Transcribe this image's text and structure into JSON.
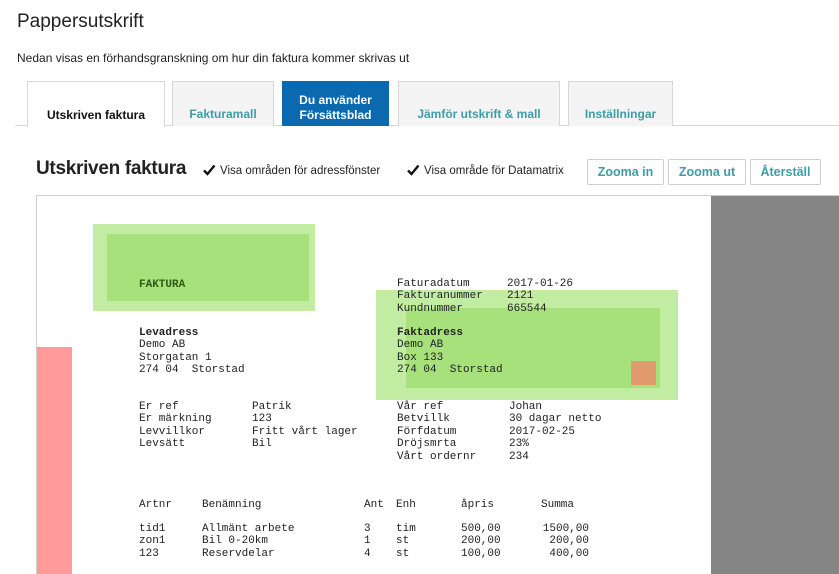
{
  "page": {
    "title": "Pappersutskrift",
    "subtitle": "Nedan visas en förhandsgranskning om hur din faktura kommer skrivas ut"
  },
  "tabs": [
    {
      "label": "Utskriven faktura",
      "state": "active"
    },
    {
      "label": "Fakturamall",
      "state": "normal"
    },
    {
      "label_line1": "Du använder",
      "label_line2": "Försättsblad",
      "state": "primary"
    },
    {
      "label": "Jämför utskrift & mall",
      "state": "normal"
    },
    {
      "label": "Inställningar",
      "state": "normal"
    }
  ],
  "toolbar": {
    "title": "Utskriven faktura",
    "checkbox_address": {
      "label": "Visa områden för adressfönster",
      "checked": true
    },
    "checkbox_datamatrix": {
      "label": "Visa område för Datamatrix",
      "checked": true
    },
    "zoom_in": "Zooma in",
    "zoom_out": "Zooma ut",
    "reset": "Återställ"
  },
  "colors": {
    "accent": "#3f9ca6",
    "primary_tab": "#0b69b0",
    "address_window": "#a7e17c",
    "address_window_margin": "#c3eca3",
    "datamatrix": "#e39a6e",
    "red_margin": "#ff9b9b",
    "gray_margin": "#858585"
  },
  "invoice": {
    "heading": "FAKTURA",
    "meta_labels": [
      "Faturadatum",
      "Fakturanummer",
      "Kundnummer"
    ],
    "meta_values": [
      "2017-01-26",
      "2121",
      "665544"
    ],
    "delivery": {
      "title": "Levadress",
      "lines": [
        "Demo AB",
        "Storgatan 1",
        "274 04  Storstad"
      ]
    },
    "billing": {
      "title": "Faktadress",
      "lines": [
        "Demo AB",
        "Box 133",
        "274 04  Storstad"
      ]
    },
    "ref_left_labels": [
      "Er ref",
      "Er märkning",
      "Levvillkor",
      "Levsätt"
    ],
    "ref_left_values": [
      "Patrik",
      "123",
      "Fritt vårt lager",
      "Bil"
    ],
    "ref_right_labels": [
      "Vår ref",
      "Betvillk",
      "Förfdatum",
      "Dröjsmrta",
      "Vårt ordernr"
    ],
    "ref_right_values": [
      "Johan",
      "30 dagar netto",
      "2017-02-25",
      "23%",
      "234"
    ],
    "items_header": {
      "artnr": "Artnr",
      "benamning": "Benämning",
      "ant": "Ant",
      "enh": "Enh",
      "apris": "åpris",
      "summa": "Summa"
    },
    "items": [
      {
        "artnr": "tid1",
        "benamning": "Allmänt arbete",
        "ant": "3",
        "enh": "tim",
        "apris": "500,00",
        "summa": "1500,00"
      },
      {
        "artnr": "zon1",
        "benamning": "Bil 0-20km",
        "ant": "1",
        "enh": "st",
        "apris": "200,00",
        "summa": "200,00"
      },
      {
        "artnr": "123",
        "benamning": "Reservdelar",
        "ant": "4",
        "enh": "st",
        "apris": "100,00",
        "summa": "400,00"
      }
    ]
  }
}
